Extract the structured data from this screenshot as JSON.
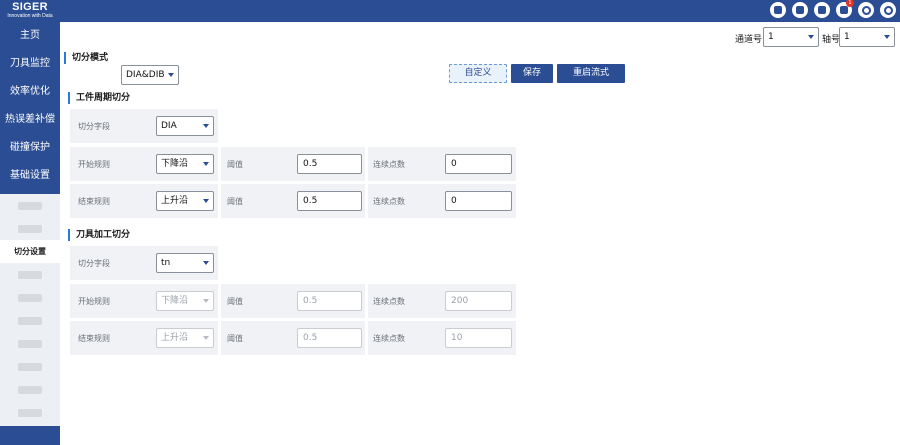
{
  "logo": {
    "name": "SIGER",
    "tagline": "Innovation with Data"
  },
  "topbar": {
    "icons": [
      "analytics-icon",
      "tools-icon",
      "shirt-icon",
      "bell-icon",
      "settings-icon",
      "compass-icon"
    ],
    "notification_count": "1"
  },
  "sidebar": {
    "items": [
      {
        "label": "主页"
      },
      {
        "label": "刀具监控"
      },
      {
        "label": "效率优化"
      },
      {
        "label": "热误差补偿"
      },
      {
        "label": "碰撞保护"
      },
      {
        "label": "基础设置"
      }
    ],
    "active_sub_label": "切分设置"
  },
  "header": {
    "channel_label": "通道号",
    "channel_value": "1",
    "axis_label": "轴号",
    "axis_value": "1"
  },
  "split_mode": {
    "title": "切分模式",
    "value": "DIA&DIB",
    "custom_label": "自定义",
    "save_label": "保存",
    "restart_label": "重启流式"
  },
  "workpiece": {
    "title": "工件周期切分",
    "field_label": "切分字段",
    "field_value": "DIA",
    "start_label": "开始规则",
    "start_value": "下降沿",
    "end_label": "结束规则",
    "end_value": "上升沿",
    "threshold_label": "阈值",
    "start_threshold": "0.5",
    "end_threshold": "0.5",
    "points_label": "连续点数",
    "start_points": "0",
    "end_points": "0"
  },
  "tool": {
    "title": "刀具加工切分",
    "field_label": "切分字段",
    "field_value": "tn",
    "start_label": "开始规则",
    "start_value": "下降沿",
    "end_label": "结束规则",
    "end_value": "上升沿",
    "threshold_label": "阈值",
    "start_threshold": "0.5",
    "end_threshold": "0.5",
    "points_label": "连续点数",
    "start_points": "200",
    "end_points": "10"
  }
}
